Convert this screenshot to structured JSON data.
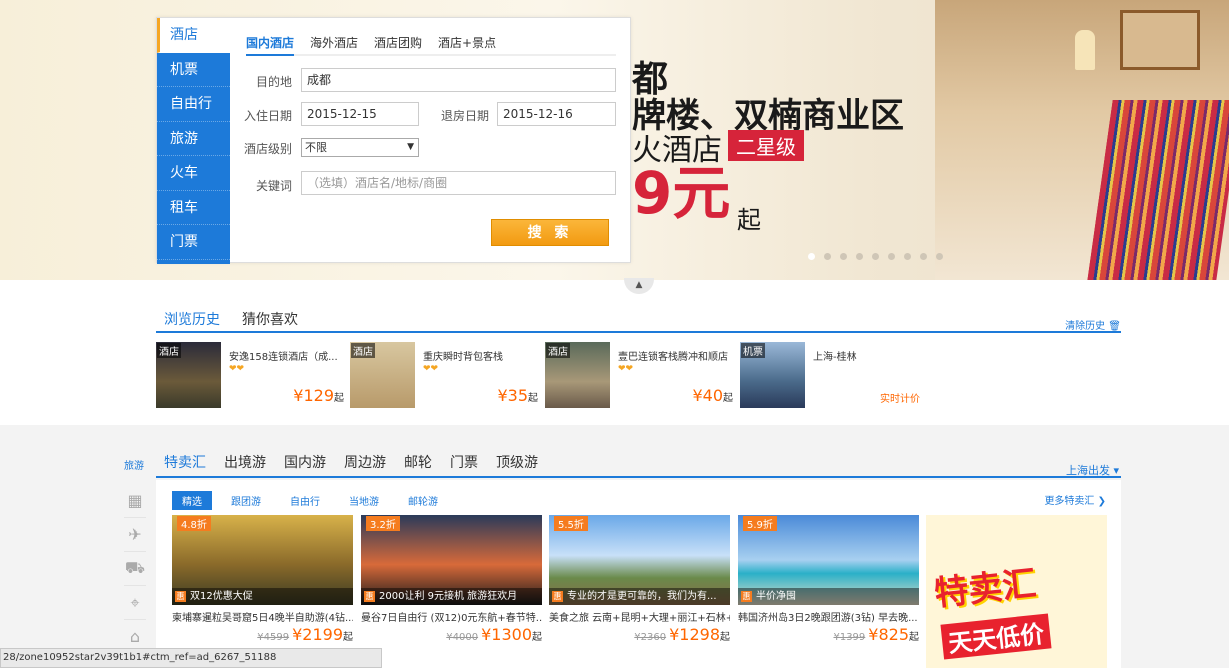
{
  "banner": {
    "line1": "都",
    "line2": "牌楼、双楠商业区",
    "line3": "火酒店",
    "tag": "二星级",
    "price": "9元",
    "price_suffix": "起",
    "dot_count": 9,
    "active_dot": 0
  },
  "search": {
    "categories": [
      "酒店",
      "机票",
      "自由行",
      "旅游",
      "火车",
      "租车",
      "门票"
    ],
    "active_category": 0,
    "tabs": [
      "国内酒店",
      "海外酒店",
      "酒店团购",
      "酒店+景点"
    ],
    "active_tab": 0,
    "destination_label": "目的地",
    "destination_value": "成都",
    "checkin_label": "入住日期",
    "checkin_value": "2015-12-15",
    "checkout_label": "退房日期",
    "checkout_value": "2015-12-16",
    "level_label": "酒店级别",
    "level_value": "不限",
    "keyword_label": "关键词",
    "keyword_placeholder": "（选填）酒店名/地标/商圈",
    "search_button": "搜 索"
  },
  "history": {
    "tab_browse": "浏览历史",
    "tab_guess": "猜你喜欢",
    "clear": "清除历史 🗑",
    "items": [
      {
        "cat": "酒店",
        "name": "安逸158连锁酒店（成...",
        "stars": "❤❤",
        "price": "¥129",
        "unit": "起"
      },
      {
        "cat": "酒店",
        "name": "重庆瞬时背包客栈",
        "stars": "❤❤",
        "price": "¥35",
        "unit": "起"
      },
      {
        "cat": "酒店",
        "name": "壹巴连锁客栈腾冲和顺店",
        "stars": "❤❤",
        "price": "¥40",
        "unit": "起"
      },
      {
        "cat": "机票",
        "name": "上海-桂林",
        "stars": "",
        "price": "",
        "unit": "",
        "realtime": "实时计价"
      }
    ]
  },
  "travel": {
    "side_label": "旅游",
    "side_icons": [
      "building-icon",
      "plane-icon",
      "car-icon",
      "pin-icon",
      "bag-icon"
    ],
    "tabs": [
      "特卖汇",
      "出境游",
      "国内游",
      "周边游",
      "邮轮",
      "门票",
      "顶级游"
    ],
    "active_tab": 0,
    "depart": "上海出发 ▾",
    "subtabs": [
      "精选",
      "跟团游",
      "自由行",
      "当地游",
      "邮轮游"
    ],
    "active_subtab": 0,
    "more": "更多特卖汇 ❯",
    "products": [
      {
        "discount": "4.8折",
        "caption": "双12优惠大促",
        "desc": "柬埔寨暹粒吴哥窟5日4晚半自助游(4钻...",
        "old": "¥4599",
        "now": "¥2199",
        "unit": "起"
      },
      {
        "discount": "3.2折",
        "caption": "2000让利 9元接机 旅游狂欢月",
        "desc": "曼谷7日自由行 (双12)0元东航+春节特...",
        "old": "¥4000",
        "now": "¥1300",
        "unit": "起"
      },
      {
        "discount": "5.5折",
        "caption": "专业的才是更可靠的，我们为有...",
        "desc": "美食之旅 云南+昆明+大理+丽江+石林+...",
        "old": "¥2360",
        "now": "¥1298",
        "unit": "起"
      },
      {
        "discount": "5.9折",
        "caption": "半价净囤",
        "desc": "韩国济州岛3日2晚跟团游(3钻) 早去晚...",
        "old": "¥1399",
        "now": "¥825",
        "unit": "起"
      }
    ],
    "ad_line1": "特卖汇",
    "ad_line2": "天天低价"
  },
  "status_url": "28/zone10952star2v39t1b1#ctm_ref=ad_6267_51188",
  "colors": {
    "accent": "#1d7ad9",
    "orange": "#f29a11",
    "price": "#ff6600",
    "red": "#d6243a"
  }
}
